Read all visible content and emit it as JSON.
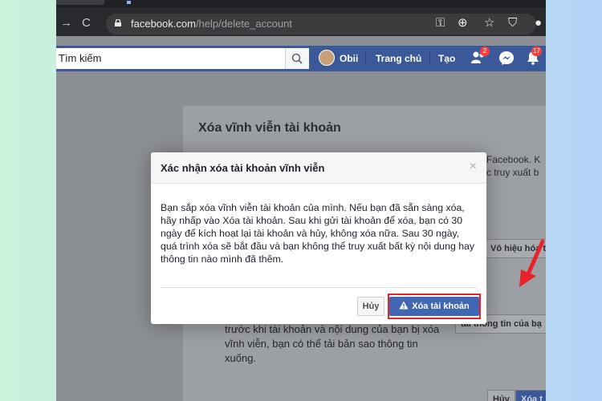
{
  "browser": {
    "url_domain": "facebook.com",
    "url_path": "/help/delete_account"
  },
  "header": {
    "search_text": "Tìm kiếm",
    "user_name": "Obii",
    "nav_home": "Trang chủ",
    "nav_create": "Tạo",
    "friend_badge": "2",
    "notif_badge": "17"
  },
  "page": {
    "title": "Xóa vĩnh viễn tài khoản",
    "right_text_1": "Facebook. K",
    "right_text_2": "c truy xuất b",
    "deactivate_button": "Vô hiệu hóa t",
    "download_button": "tải thông tin của bạ",
    "bottom_text": "trước khi tài khoản và nội dung của bạn bị xóa vĩnh viễn, bạn có thể tải bản sao thông tin xuống.",
    "bottom_cancel": "Hủy",
    "bottom_delete": "Xóa t"
  },
  "dialog": {
    "title": "Xác nhận xóa tài khoản vĩnh viễn",
    "close_glyph": "×",
    "body": "Bạn sắp xóa vĩnh viễn tài khoản của mình. Nếu bạn đã sẵn sàng xóa, hãy nhấp vào Xóa tài khoản. Sau khi gửi tài khoản để xóa, bạn có 30 ngày để kích hoạt lại tài khoản và hủy, không xóa nữa. Sau 30 ngày, quá trình xóa sẽ bắt đầu và bạn không thể truy xuất bất kỳ nội dung hay thông tin nào mình đã thêm.",
    "cancel_label": "Hủy",
    "delete_label": "Xóa tài khoản"
  },
  "icons": {
    "warning_icon": "warning-triangle",
    "annotation_arrow": "red-arrow"
  },
  "colors": {
    "facebook_blue": "#3b5998",
    "button_blue": "#4267b2",
    "highlight_red": "#e8232b"
  }
}
